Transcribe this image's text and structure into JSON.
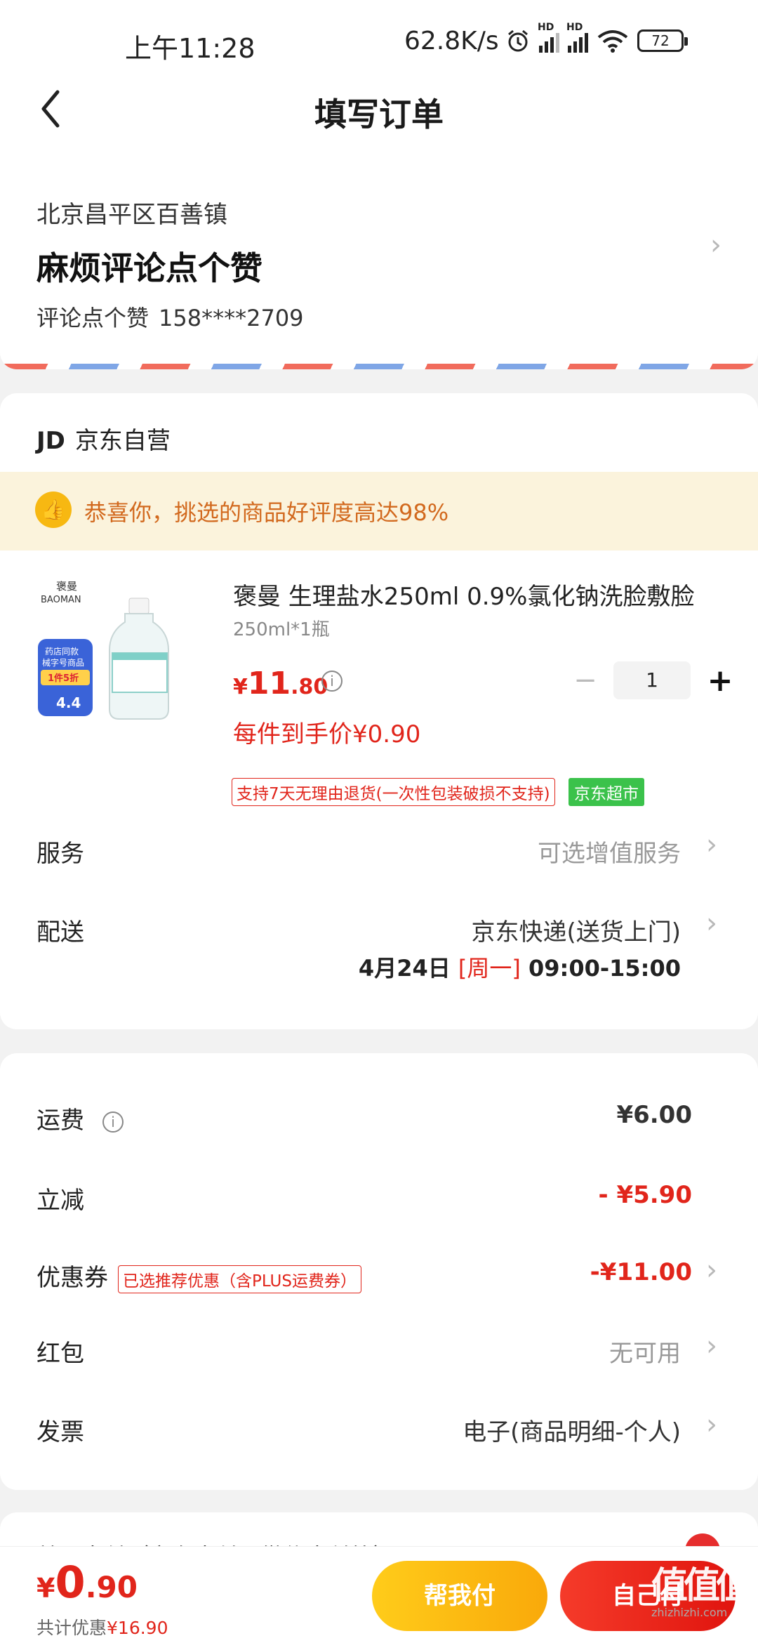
{
  "status_bar": {
    "time": "上午11:28",
    "network_speed": "62.8K/s",
    "battery": "72",
    "icons": [
      "alarm-icon",
      "hd-signal-icon",
      "hd-signal-icon",
      "wifi-icon",
      "battery-icon"
    ]
  },
  "header": {
    "title": "填写订单",
    "back_icon": "chevron-left-icon"
  },
  "address": {
    "region": "北京昌平区百善镇",
    "detail": "麻烦评论点个赞",
    "recipient": "评论点个赞",
    "phone": "158****2709"
  },
  "store": {
    "logo_text": "JD",
    "name": "京东自营"
  },
  "banner": {
    "text": "恭喜你，挑选的商品好评度高达98%",
    "icon": "thumbs-up-icon"
  },
  "product": {
    "brand_cn": "褒曼",
    "brand_en": "BAOMAN",
    "badge_line1": "药店同款",
    "badge_line2": "械字号商品",
    "badge_discount": "1件5折",
    "badge_rating": "4.4",
    "name": "褒曼  生理盐水250ml 0.9%氯化钠洗脸敷脸",
    "spec": "250ml*1瓶",
    "price_symbol": "¥",
    "price_int": "11",
    "price_dec": ".80",
    "per_item_price": "每件到手价¥0.90",
    "quantity": "1",
    "minus_label": "−",
    "plus_label": "+",
    "return_tag": "支持7天无理由退货(一次性包装破损不支持)",
    "market_tag": "京东超市"
  },
  "service": {
    "label": "服务",
    "value": "可选增值服务"
  },
  "delivery": {
    "label": "配送",
    "value": "京东快递(送货上门)",
    "date": "4月24日",
    "weekday": "[周一]",
    "time": "09:00-15:00"
  },
  "fees": {
    "shipping_label": "运费",
    "shipping_value": "¥6.00",
    "reduction_label": "立减",
    "reduction_value": "- ¥5.90",
    "coupon_label": "优惠券",
    "coupon_tag": "已选推荐优惠（含PLUS运费券）",
    "coupon_value": "-¥11.00",
    "redpacket_label": "红包",
    "redpacket_value": "无可用",
    "invoice_label": "发票",
    "invoice_value": "电子(商品明细-个人)"
  },
  "payment_peek": {
    "text": "普通支付（京东支付、微信支付等）"
  },
  "bottom_bar": {
    "total_symbol": "¥",
    "total_int": "0",
    "total_dec": ".90",
    "discount_label": "共计优惠",
    "discount_value": "¥16.90",
    "help_pay": "帮我付",
    "self_pay": "自己付"
  },
  "watermark": {
    "logo": "值值值",
    "url": "zhizhizhi.com"
  },
  "colors": {
    "accent_red": "#e1251b",
    "banner_bg": "#fbf3dc",
    "banner_text": "#d2691e",
    "help_button": "#fbbd12",
    "self_button": "#ea2618",
    "market_tag": "#3bc24b"
  }
}
